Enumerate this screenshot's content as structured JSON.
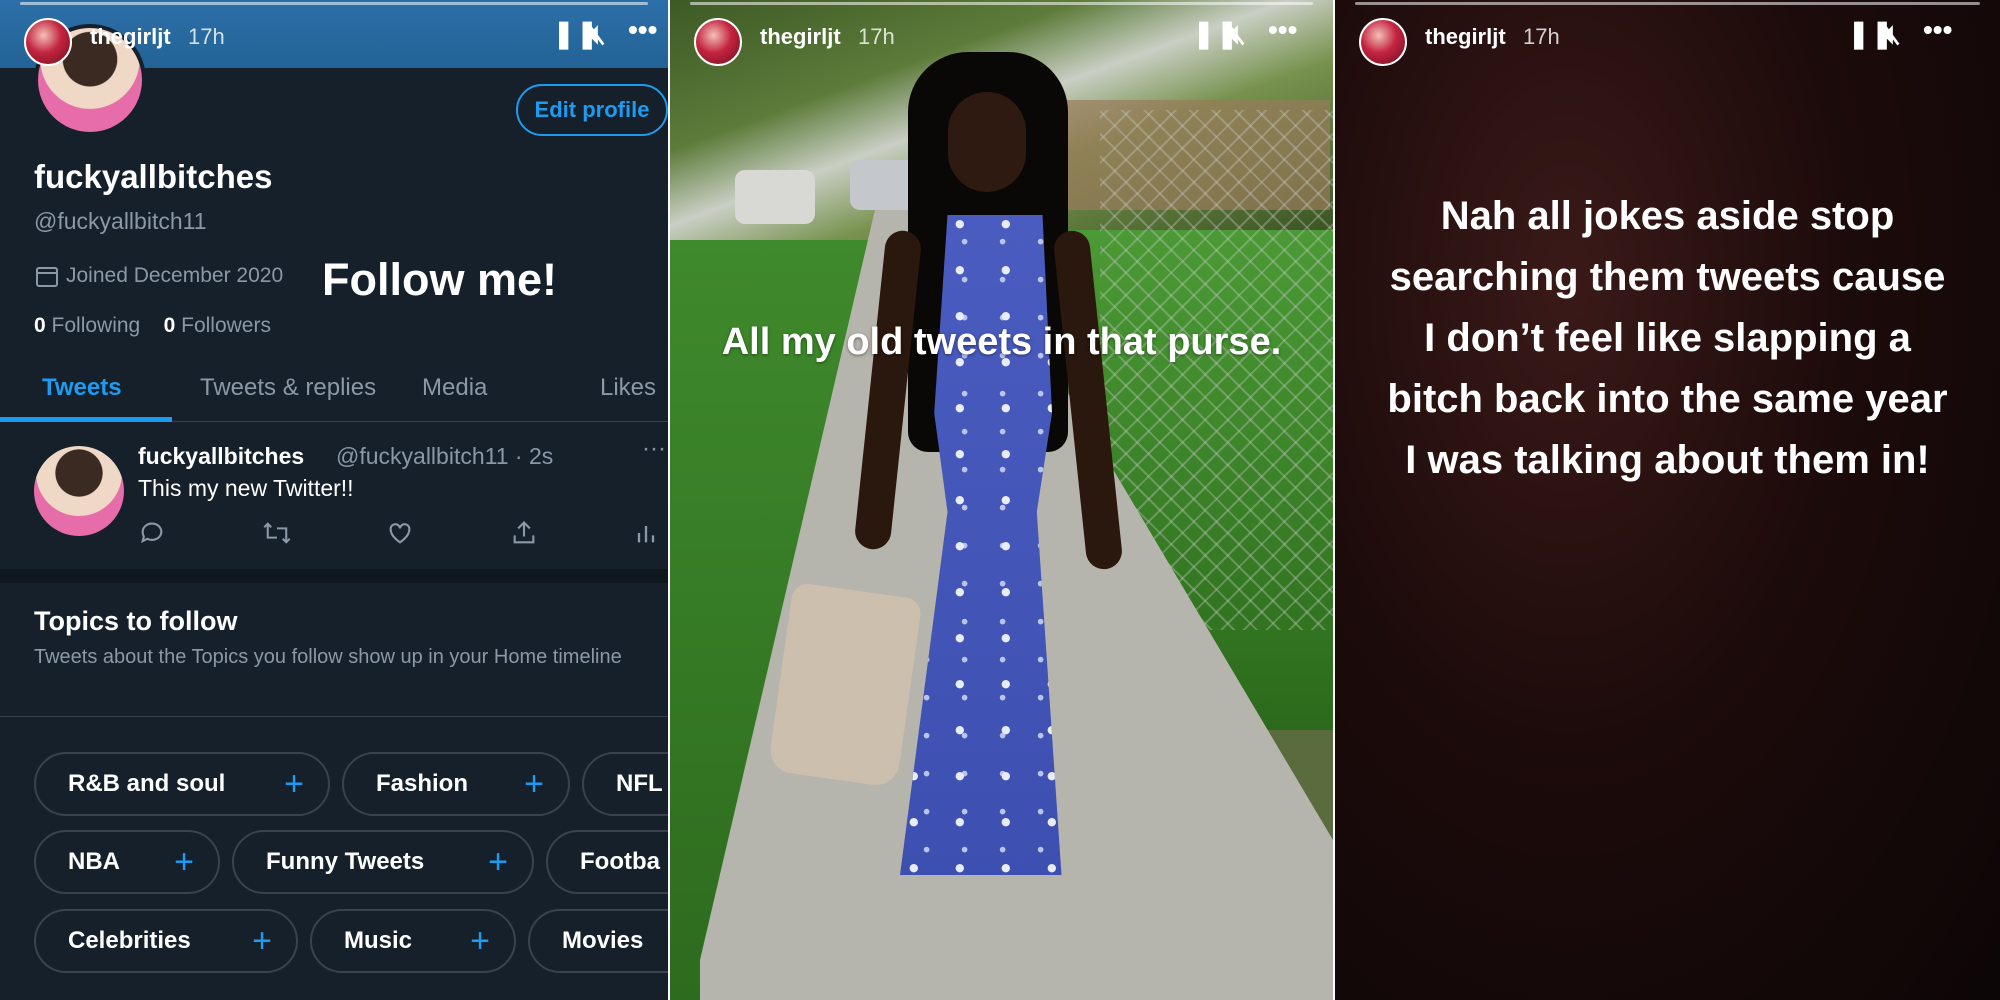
{
  "story": {
    "username": "thegirljt",
    "time": "17h",
    "pause_icon": "pause-icon",
    "mute_icon": "muted-speaker-icon",
    "more_icon": "more-dots-icon"
  },
  "panel1": {
    "edit_profile_label": "Edit profile",
    "display_name": "fuckyallbitches",
    "handle": "@fuckyallbitch11",
    "joined": "Joined December 2020",
    "overlay_text": "Follow me!",
    "following_count": "0",
    "following_label": "Following",
    "followers_count": "0",
    "followers_label": "Followers",
    "tabs": [
      {
        "label": "Tweets",
        "active": true
      },
      {
        "label": "Tweets & replies",
        "active": false
      },
      {
        "label": "Media",
        "active": false
      },
      {
        "label": "Likes",
        "active": false
      }
    ],
    "tweet": {
      "name": "fuckyallbitches",
      "handle_time": "@fuckyallbitch11 · 2s",
      "text": "This my new Twitter!!",
      "more_label": "···"
    },
    "topics_title": "Topics to follow",
    "topics_desc": "Tweets about the Topics you follow show up in your Home timeline",
    "topics": [
      "R&B and soul",
      "Fashion",
      "NFL",
      "NBA",
      "Funny Tweets",
      "Footba",
      "Celebrities",
      "Music",
      "Movies"
    ],
    "accent_color": "#1d9bf0"
  },
  "panel2": {
    "caption": "All my old tweets in that purse."
  },
  "panel3": {
    "text": "Nah all jokes aside stop searching them tweets cause I don’t feel like slapping a bitch back into the same year I was talking about them in!"
  }
}
